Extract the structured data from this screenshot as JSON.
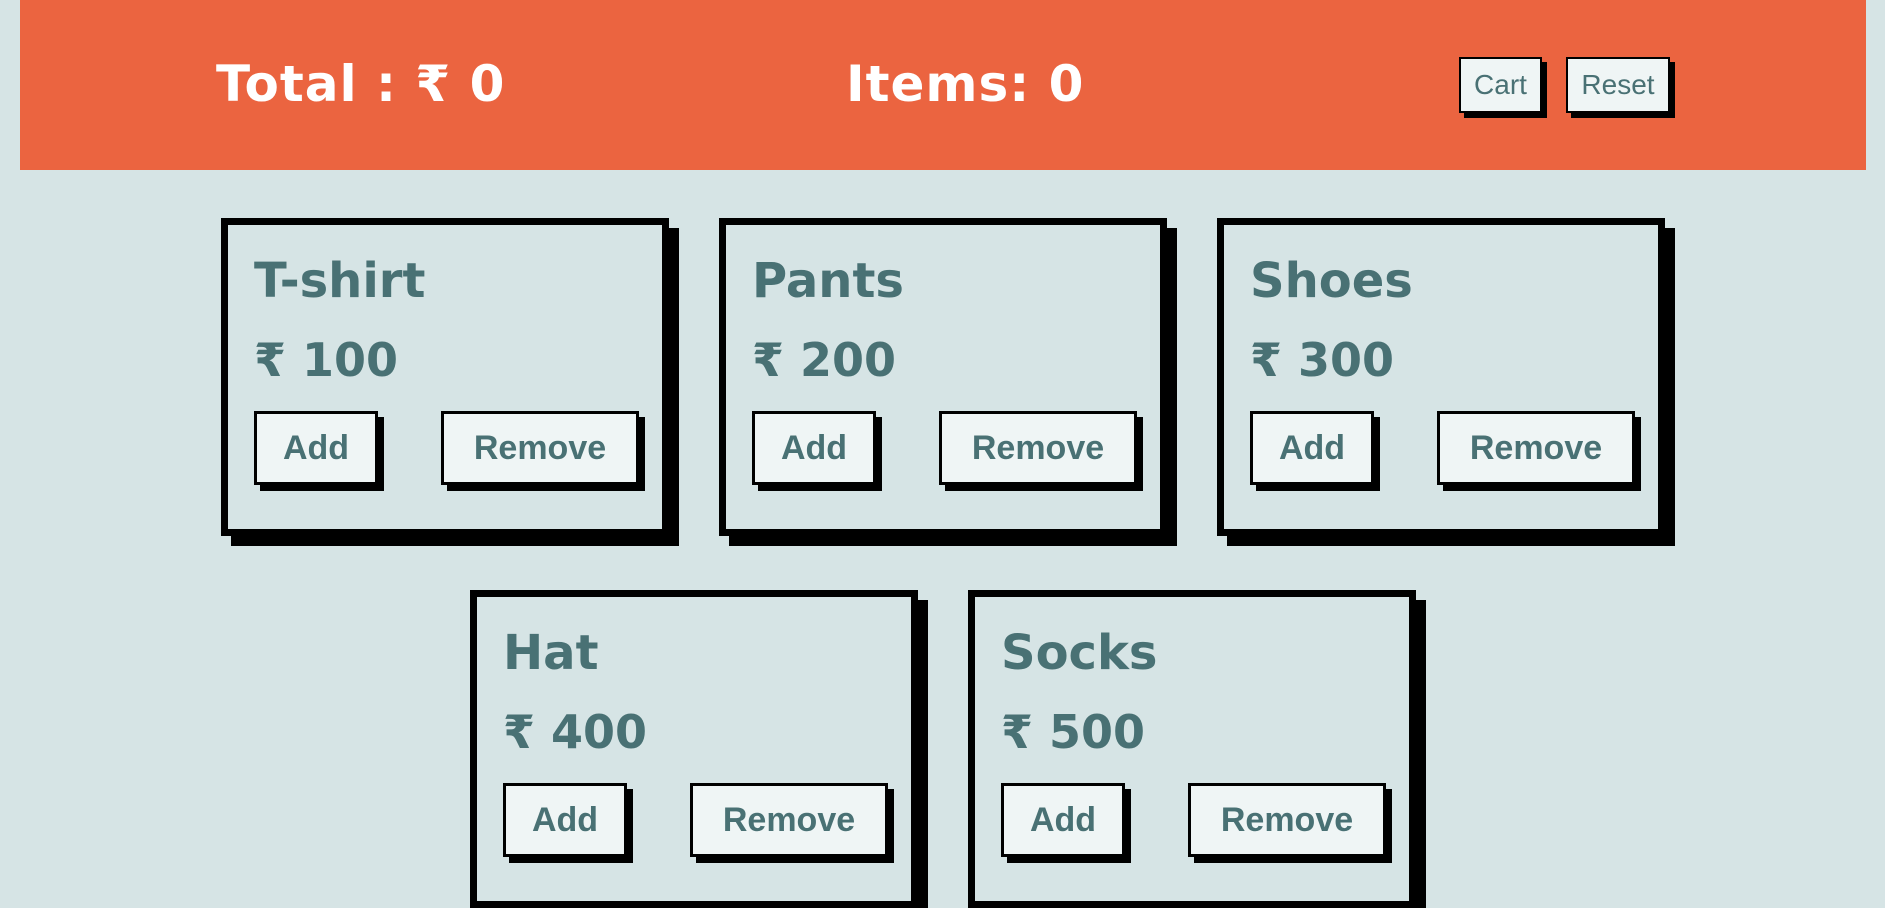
{
  "header": {
    "total_text": "Total : ₹ 0",
    "items_text": "Items: 0",
    "cart_label": "Cart",
    "reset_label": "Reset"
  },
  "products": [
    {
      "name": "T-shirt",
      "price": "₹ 100",
      "add_label": "Add",
      "remove_label": "Remove"
    },
    {
      "name": "Pants",
      "price": "₹ 200",
      "add_label": "Add",
      "remove_label": "Remove"
    },
    {
      "name": "Shoes",
      "price": "₹ 300",
      "add_label": "Add",
      "remove_label": "Remove"
    },
    {
      "name": "Hat",
      "price": "₹ 400",
      "add_label": "Add",
      "remove_label": "Remove"
    },
    {
      "name": "Socks",
      "price": "₹ 500",
      "add_label": "Add",
      "remove_label": "Remove"
    }
  ],
  "colors": {
    "header_bg": "#eb6440",
    "page_bg": "#d6e4e5",
    "text": "#497174",
    "button_bg": "#eff5f5"
  }
}
